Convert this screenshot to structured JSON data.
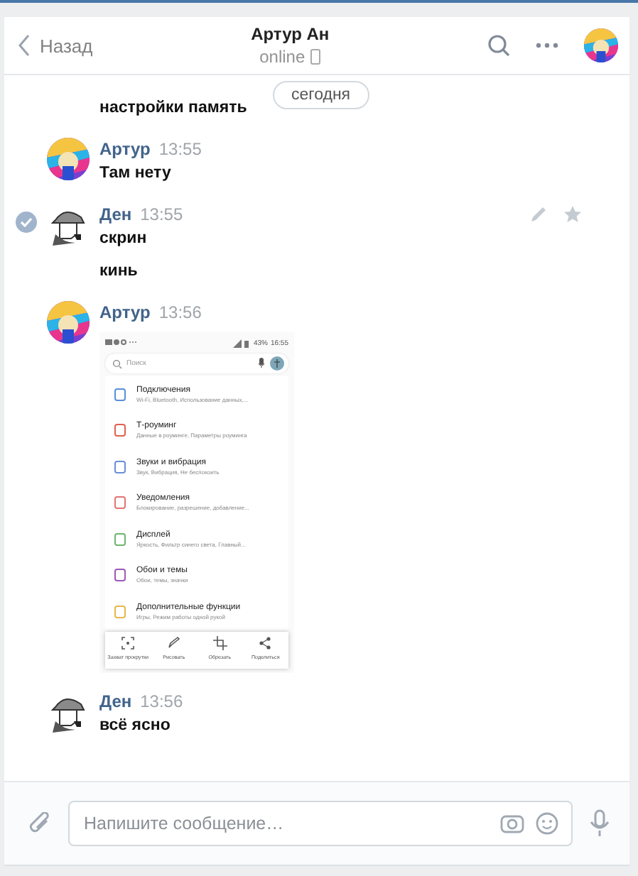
{
  "header": {
    "back": "Назад",
    "title": "Артур Ан",
    "status": "online"
  },
  "date_divider": "сегодня",
  "messages": [
    {
      "kind": "continuation",
      "lines": [
        "настройки память"
      ]
    },
    {
      "kind": "group",
      "author": "Артур",
      "avatar": {
        "kind": "artur"
      },
      "time": "13:55",
      "selected": false,
      "lines": [
        "Там нету"
      ]
    },
    {
      "kind": "group",
      "author": "Ден",
      "avatar": {
        "kind": "den"
      },
      "time": "13:55",
      "selected": true,
      "lines": [
        "скрин",
        "кинь"
      ]
    },
    {
      "kind": "group",
      "author": "Артур",
      "avatar": {
        "kind": "artur"
      },
      "time": "13:56",
      "selected": false,
      "attachment": {
        "status_battery": "43%",
        "status_time": "16:55",
        "search_placeholder": "Поиск",
        "items": [
          {
            "title": "Подключения",
            "subtitle": "Wi-Fi, Bluetooth, Использование данных,...",
            "color": "#5b8fd6"
          },
          {
            "title": "Т-роуминг",
            "subtitle": "Данные в роуминге, Параметры роуминга",
            "color": "#e0604f"
          },
          {
            "title": "Звуки и вибрация",
            "subtitle": "Звук, Вибрация, Не беспокоить",
            "color": "#6a8fd8"
          },
          {
            "title": "Уведомления",
            "subtitle": "Блокирование, разрешение, добавление...",
            "color": "#e57373"
          },
          {
            "title": "Дисплей",
            "subtitle": "Яркость, Фильтр синего света, Главный...",
            "color": "#6db56d"
          },
          {
            "title": "Обои и темы",
            "subtitle": "Обои, темы, значки",
            "color": "#9b59b6"
          },
          {
            "title": "Дополнительные функции",
            "subtitle": "Игры, Режим работы одной рукой",
            "color": "#e6b84a"
          }
        ],
        "toolbar": [
          "Захват прокрутки",
          "Рисовать",
          "Обрезать",
          "Поделиться"
        ]
      }
    },
    {
      "kind": "group",
      "author": "Ден",
      "avatar": {
        "kind": "den"
      },
      "time": "13:56",
      "selected": false,
      "lines": [
        "всё ясно"
      ]
    }
  ],
  "composer": {
    "placeholder": "Напишите сообщение…"
  }
}
